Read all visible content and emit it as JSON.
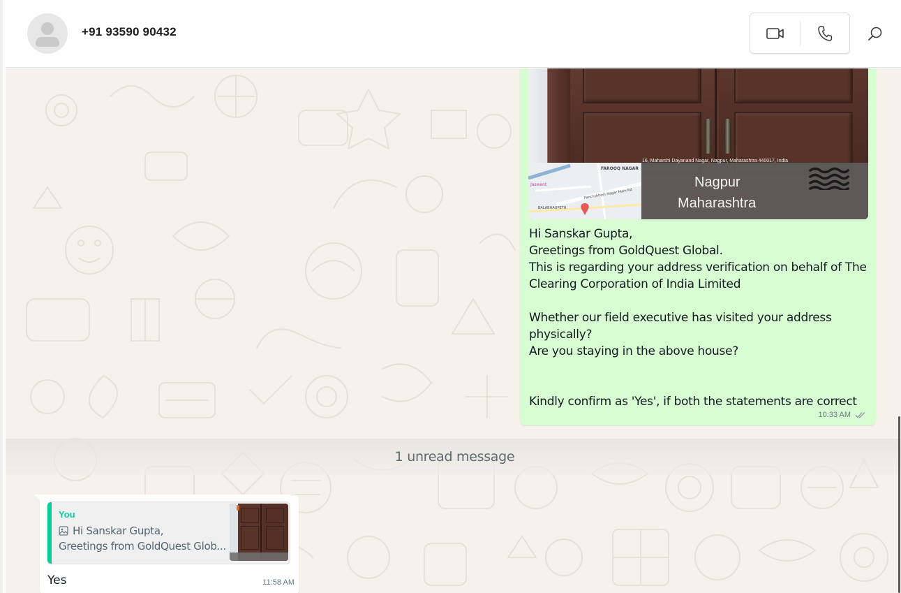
{
  "header": {
    "contact_name": "+91 93590 90432",
    "video_call_icon": "video-call-icon",
    "voice_call_icon": "voice-call-icon",
    "search_icon": "search-icon"
  },
  "outgoing_message": {
    "media": {
      "map_labels": [
        "FAROOQ NAGAR",
        "Jaswant",
        "Panchshheel Nagar Main Rd",
        "BALABHAUPETH"
      ],
      "address_line": "16, Maharshi Dayanand Nagar, Nagpur, Maharashtra 440017, India",
      "city": "Nagpur",
      "state": "Maharashtra"
    },
    "text": "Hi Sanskar Gupta,\nGreetings from GoldQuest Global.\nThis is regarding your address verification on behalf of The Clearing Corporation of India Limited\n\nWhether our field executive has visited your address physically?\nAre you staying in the above house?\n\n\nKindly confirm as 'Yes', if both the statements are correct",
    "time": "10:33 AM",
    "status_icon": "double-check-icon"
  },
  "unread_divider": "1 unread message",
  "incoming_message": {
    "quote": {
      "author": "You",
      "line1": "Hi Sanskar Gupta,",
      "line2": "Greetings from GoldQuest Glob...",
      "media_icon": "image-icon"
    },
    "text": "Yes",
    "time": "11:58 AM"
  },
  "colors": {
    "outgoing_bubble": "#d9fdd3",
    "incoming_bubble": "#ffffff",
    "chat_background": "#f5f1eb",
    "quote_accent": "#06cf9c"
  }
}
